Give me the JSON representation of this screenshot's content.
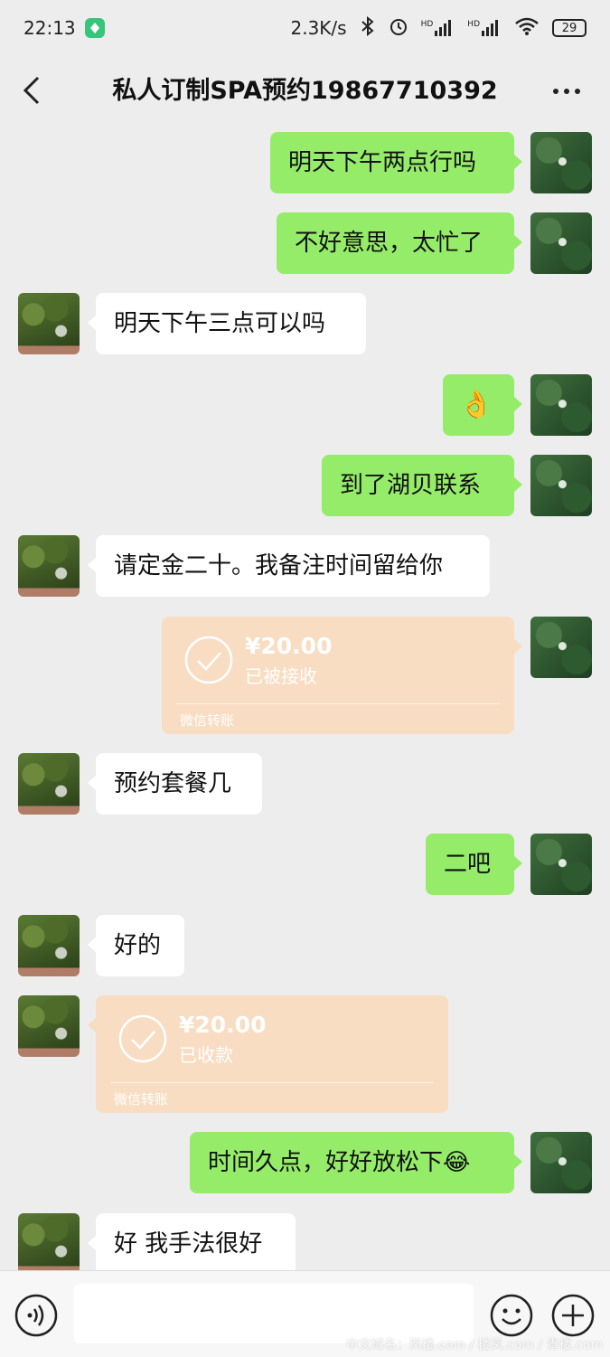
{
  "status_bar": {
    "time": "22:13",
    "speed": "2.3K/s",
    "signal1": "HD",
    "signal2": "HD",
    "battery": "29"
  },
  "header": {
    "title": "私人订制SPA预约19867710392"
  },
  "messages": [
    {
      "side": "me",
      "type": "text",
      "text": "明天下午两点行吗"
    },
    {
      "side": "me",
      "type": "text",
      "text": "不好意思，太忙了"
    },
    {
      "side": "other",
      "type": "text",
      "text": "明天下午三点可以吗"
    },
    {
      "side": "me",
      "type": "emoji",
      "text": "👌"
    },
    {
      "side": "me",
      "type": "text",
      "text": "到了湖贝联系"
    },
    {
      "side": "other",
      "type": "text",
      "text": "请定金二十。我备注时间留给你"
    },
    {
      "side": "me",
      "type": "transfer",
      "amount": "¥20.00",
      "status": "已被接收",
      "source": "微信转账"
    },
    {
      "side": "other",
      "type": "text",
      "text": "预约套餐几"
    },
    {
      "side": "me",
      "type": "text",
      "text": "二吧"
    },
    {
      "side": "other",
      "type": "text",
      "text": "好的"
    },
    {
      "side": "other",
      "type": "transfer",
      "amount": "¥20.00",
      "status": "已收款",
      "source": "微信转账"
    },
    {
      "side": "me",
      "type": "text",
      "text": "时间久点，好好放松下😂"
    },
    {
      "side": "other",
      "type": "text",
      "text": "好 我手法很好"
    }
  ],
  "input_bar": {
    "placeholder": ""
  },
  "watermark": "中文域名：凤楼.com / 楼凤.com / 青楼.com",
  "colors": {
    "green_bubble": "#95ec69",
    "white_bubble": "#ffffff",
    "transfer_bubble": "#f8ddc3",
    "background": "#ededed"
  }
}
